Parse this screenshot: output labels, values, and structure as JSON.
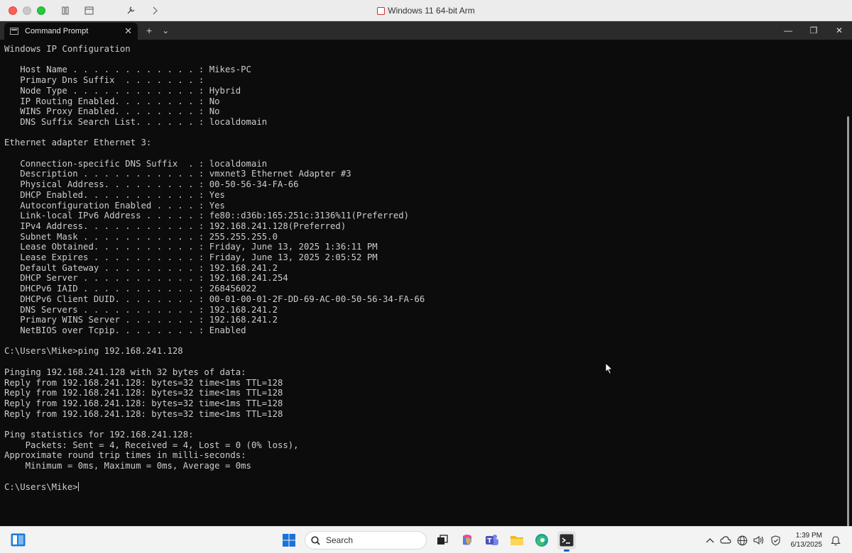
{
  "host_window": {
    "title": "Windows 11 64-bit Arm"
  },
  "terminal": {
    "tab_label": "Command Prompt",
    "tab_close": "✕",
    "new_tab": "+",
    "dropdown": "⌄",
    "minimize": "—",
    "maximize": "❐",
    "close": "✕",
    "lines": [
      "Windows IP Configuration",
      "",
      "   Host Name . . . . . . . . . . . . : Mikes-PC",
      "   Primary Dns Suffix  . . . . . . . :",
      "   Node Type . . . . . . . . . . . . : Hybrid",
      "   IP Routing Enabled. . . . . . . . : No",
      "   WINS Proxy Enabled. . . . . . . . : No",
      "   DNS Suffix Search List. . . . . . : localdomain",
      "",
      "Ethernet adapter Ethernet 3:",
      "",
      "   Connection-specific DNS Suffix  . : localdomain",
      "   Description . . . . . . . . . . . : vmxnet3 Ethernet Adapter #3",
      "   Physical Address. . . . . . . . . : 00-50-56-34-FA-66",
      "   DHCP Enabled. . . . . . . . . . . : Yes",
      "   Autoconfiguration Enabled . . . . : Yes",
      "   Link-local IPv6 Address . . . . . : fe80::d36b:165:251c:3136%11(Preferred)",
      "   IPv4 Address. . . . . . . . . . . : 192.168.241.128(Preferred)",
      "   Subnet Mask . . . . . . . . . . . : 255.255.255.0",
      "   Lease Obtained. . . . . . . . . . : Friday, June 13, 2025 1:36:11 PM",
      "   Lease Expires . . . . . . . . . . : Friday, June 13, 2025 2:05:52 PM",
      "   Default Gateway . . . . . . . . . : 192.168.241.2",
      "   DHCP Server . . . . . . . . . . . : 192.168.241.254",
      "   DHCPv6 IAID . . . . . . . . . . . : 268456022",
      "   DHCPv6 Client DUID. . . . . . . . : 00-01-00-01-2F-DD-69-AC-00-50-56-34-FA-66",
      "   DNS Servers . . . . . . . . . . . : 192.168.241.2",
      "   Primary WINS Server . . . . . . . : 192.168.241.2",
      "   NetBIOS over Tcpip. . . . . . . . : Enabled",
      "",
      "C:\\Users\\Mike>ping 192.168.241.128",
      "",
      "Pinging 192.168.241.128 with 32 bytes of data:",
      "Reply from 192.168.241.128: bytes=32 time<1ms TTL=128",
      "Reply from 192.168.241.128: bytes=32 time<1ms TTL=128",
      "Reply from 192.168.241.128: bytes=32 time<1ms TTL=128",
      "Reply from 192.168.241.128: bytes=32 time<1ms TTL=128",
      "",
      "Ping statistics for 192.168.241.128:",
      "    Packets: Sent = 4, Received = 4, Lost = 0 (0% loss),",
      "Approximate round trip times in milli-seconds:",
      "    Minimum = 0ms, Maximum = 0ms, Average = 0ms",
      ""
    ],
    "prompt": "C:\\Users\\Mike>"
  },
  "taskbar": {
    "search_placeholder": "Search",
    "time": "1:39 PM",
    "date": "6/13/2025",
    "pinned_icons": [
      "windows-start-icon",
      "task-view-icon",
      "copilot-icon",
      "teams-icon",
      "file-explorer-icon",
      "edge-icon",
      "terminal-icon"
    ],
    "tray_icons": [
      "chevron-up-icon",
      "cloud-icon",
      "globe-icon",
      "speaker-icon",
      "shield-icon",
      "bell-icon"
    ]
  },
  "colors": {
    "console_bg": "#0c0c0c",
    "console_text": "#cccccc",
    "taskbar_bg": "#f3f3f3",
    "accent": "#0067c0"
  }
}
